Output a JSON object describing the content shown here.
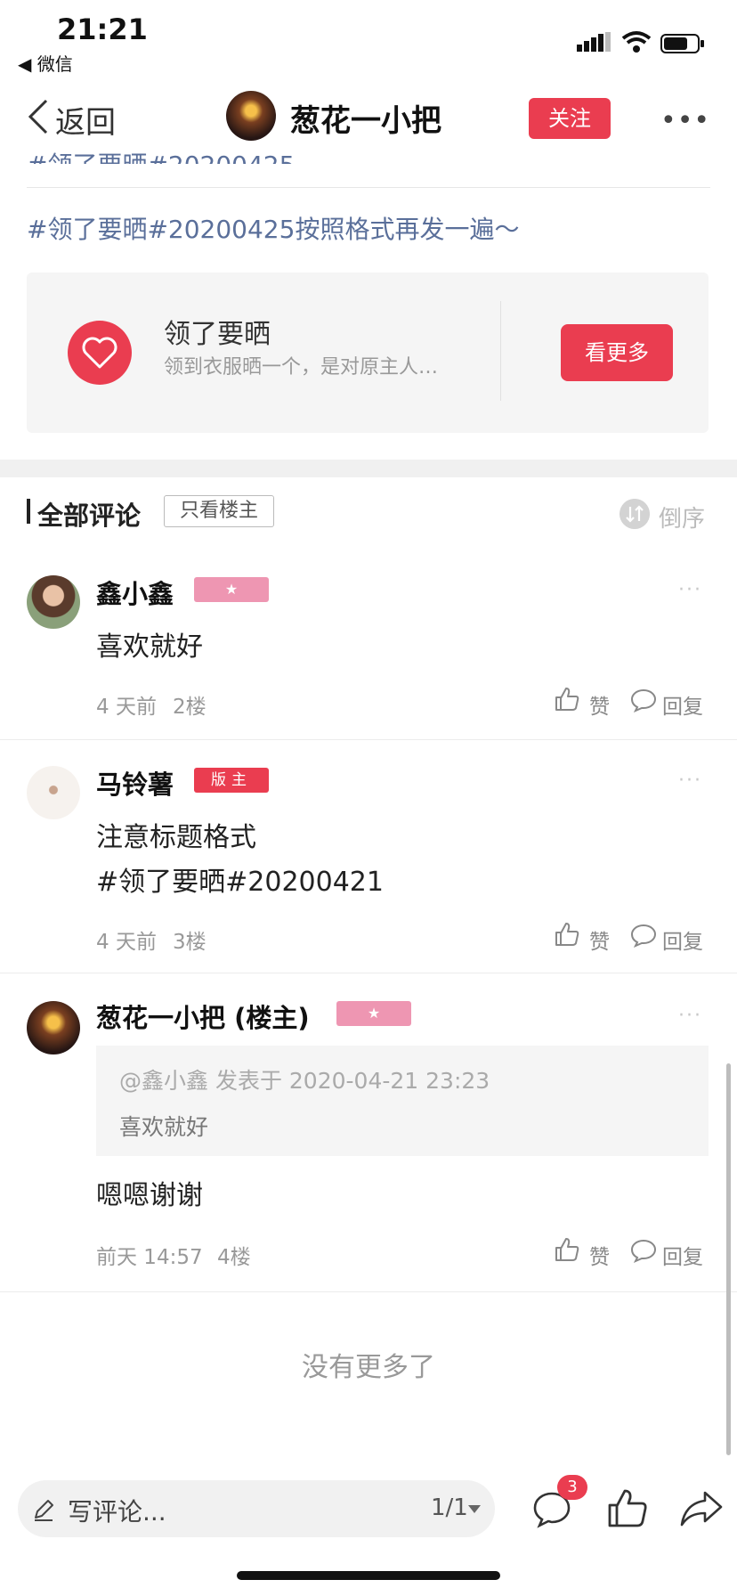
{
  "status_bar": {
    "time": "21:21",
    "back_app": "◀ 微信"
  },
  "nav": {
    "back_label": "返回",
    "title": "葱花一小把",
    "follow_label": "关注",
    "more": "•••"
  },
  "post": {
    "topic_partial": "#领了要晒#20200425",
    "topic_line": "#领了要晒#20200425按照格式再发一遍～",
    "card": {
      "title": "领了要晒",
      "desc": "领到衣服晒一个，是对原主人…",
      "button": "看更多"
    }
  },
  "comments_header": {
    "title": "全部评论",
    "only_owner": "只看楼主",
    "order_label": "倒序"
  },
  "comments": [
    {
      "name": "鑫小鑫",
      "badge": "★",
      "more": "···",
      "text": "喜欢就好",
      "time": "4 天前",
      "floor": "2楼",
      "like": "赞",
      "reply": "回复"
    },
    {
      "name": "马铃薯",
      "badge": "版主",
      "more": "···",
      "text_lines": [
        "注意标题格式",
        "#领了要晒#20200421"
      ],
      "time": "4 天前",
      "floor": "3楼",
      "like": "赞",
      "reply": "回复"
    },
    {
      "name": "葱花一小把 (楼主)",
      "badge": "★",
      "more": "···",
      "quote": {
        "head": "@鑫小鑫 发表于 2020-04-21 23:23",
        "body": "喜欢就好"
      },
      "text": "嗯嗯谢谢",
      "time": "前天 14:57",
      "floor": "4楼",
      "like": "赞",
      "reply": "回复"
    }
  ],
  "footer": {
    "no_more": "没有更多了"
  },
  "bottom_bar": {
    "placeholder": "写评论...",
    "page": "1/1",
    "comment_count": "3"
  },
  "colors": {
    "accent": "#ea3d50",
    "topic": "#5a6f9a",
    "badge_pink": "#ee96b2"
  }
}
